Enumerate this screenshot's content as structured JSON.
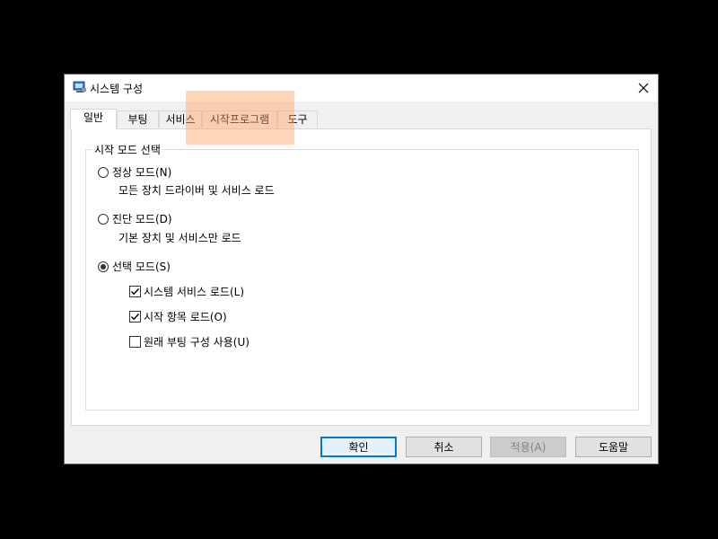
{
  "window": {
    "title": "시스템 구성",
    "close_glyph": "✕"
  },
  "tabs": [
    {
      "label": "일반",
      "active": true
    },
    {
      "label": "부팅",
      "active": false
    },
    {
      "label": "서비스",
      "active": false
    },
    {
      "label": "시작프로그램",
      "active": false
    },
    {
      "label": "도구",
      "active": false
    }
  ],
  "startup_group": {
    "legend": "시작 모드 선택",
    "normal": {
      "label": "정상 모드(N)",
      "desc": "모든 장치 드라이버 및 서비스 로드",
      "checked": false
    },
    "diagnostic": {
      "label": "진단 모드(D)",
      "desc": "기본 장치 및 서비스만 로드",
      "checked": false
    },
    "selective": {
      "label": "선택 모드(S)",
      "checked": true,
      "options": [
        {
          "label": "시스템 서비스 로드(L)",
          "checked": true
        },
        {
          "label": "시작 항목 로드(O)",
          "checked": true
        },
        {
          "label": "원래 부팅 구성 사용(U)",
          "checked": false
        }
      ]
    }
  },
  "buttons": {
    "ok": "확인",
    "cancel": "취소",
    "apply": "적용(A)",
    "help": "도움말"
  },
  "colors": {
    "accent": "#0078d7",
    "highlight": "#ffa564"
  }
}
